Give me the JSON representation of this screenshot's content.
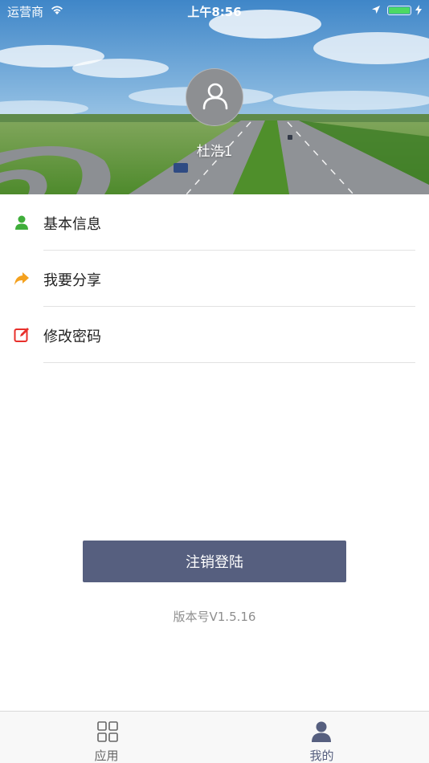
{
  "status_bar": {
    "carrier": "运营商",
    "time": "上午8:56",
    "battery_level": 1.0
  },
  "profile": {
    "user_name": "杜浩1",
    "avatar_icon": "person-outline-icon"
  },
  "menu": {
    "items": [
      {
        "label": "基本信息",
        "icon": "person-icon",
        "color": "#3fae3a"
      },
      {
        "label": "我要分享",
        "icon": "share-arrow-icon",
        "color": "#f4a11e"
      },
      {
        "label": "修改密码",
        "icon": "edit-icon",
        "color": "#e8302c"
      }
    ]
  },
  "logout": {
    "label": "注销登陆",
    "color": "#565f7f"
  },
  "version": {
    "text": "版本号V1.5.16"
  },
  "tab_bar": {
    "tabs": [
      {
        "label": "应用",
        "icon": "grid-icon",
        "active": false,
        "color": "#666666"
      },
      {
        "label": "我的",
        "icon": "person-filled-icon",
        "active": true,
        "color": "#565f7f"
      }
    ]
  }
}
